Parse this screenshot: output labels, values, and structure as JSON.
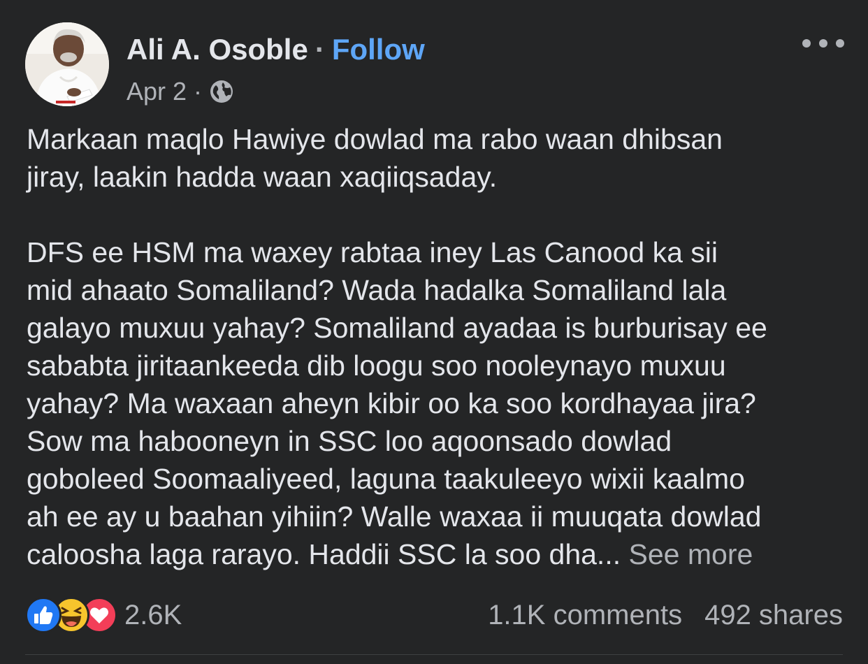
{
  "author": {
    "name": "Ali A. Osoble",
    "separator": "·",
    "follow_label": "Follow",
    "avatar_icon": "profile-photo"
  },
  "meta": {
    "date": "Apr 2",
    "separator": "·",
    "audience_icon": "globe-icon"
  },
  "more_icon": "more-options-icon",
  "post": {
    "paragraph1_lines": [
      "Markaan maqlo Hawiye dowlad ma rabo waan dhibsan",
      "jiray, laakin hadda waan xaqiiqsaday."
    ],
    "paragraph2_lines": [
      "DFS ee HSM ma waxey rabtaa iney Las Canood ka sii",
      "mid ahaato Somaliland? Wada hadalka Somaliland lala",
      "galayo muxuu yahay? Somaliland ayadaa is burburisay ee",
      "sababta jiritaankeeda dib loogu soo nooleynayo muxuu",
      "yahay? Ma waxaan aheyn kibir oo ka soo kordhayaa jira?",
      "Sow ma habooneyn in SSC loo aqoonsado dowlad",
      "goboleed Soomaaliyeed, laguna taakuleeyo wixii kaalmo",
      "ah ee ay u baahan yihiin? Walle waxaa ii muuqata dowlad"
    ],
    "last_line_text": "caloosha laga rarayo. Haddii SSC la soo dha...",
    "see_more_label": "See more"
  },
  "reactions": {
    "icons": [
      "like-icon",
      "haha-icon",
      "love-icon"
    ],
    "colors": {
      "like": "#2078f4",
      "haha": "#f7c52d",
      "love": "#f33e58"
    },
    "count": "2.6K"
  },
  "stats": {
    "comments": "1.1K comments",
    "shares": "492 shares"
  },
  "theme": {
    "background": "#242526",
    "text": "#e4e6eb",
    "secondary_text": "#b0b3b8",
    "link": "#5ea6f7"
  }
}
